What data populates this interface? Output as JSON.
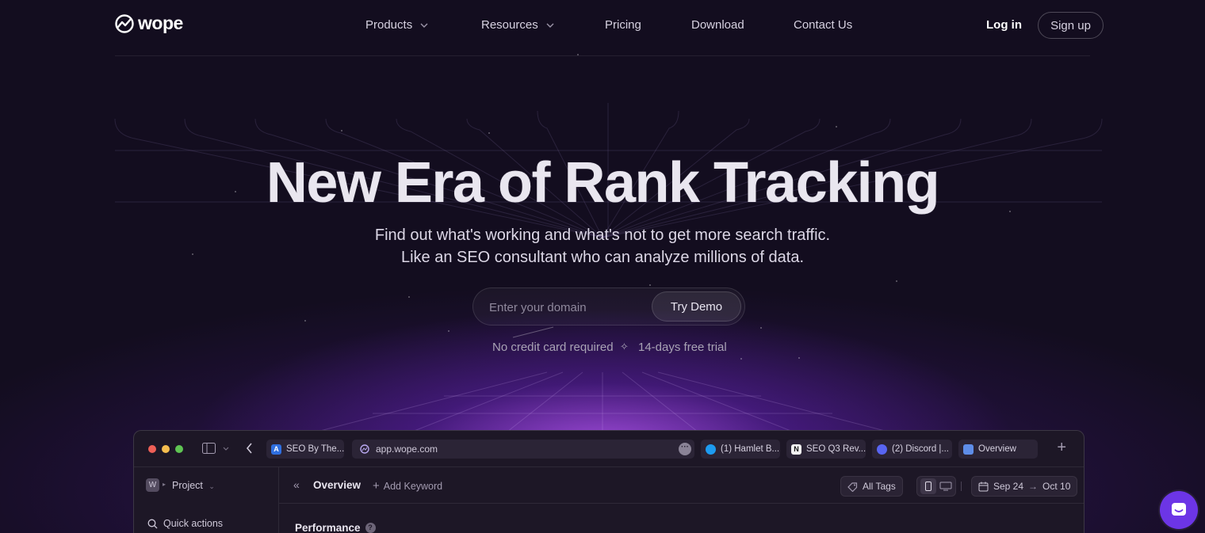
{
  "brand": {
    "name": "wope"
  },
  "nav": {
    "items": [
      {
        "label": "Products",
        "dropdown": true
      },
      {
        "label": "Resources",
        "dropdown": true
      },
      {
        "label": "Pricing",
        "dropdown": false
      },
      {
        "label": "Download",
        "dropdown": false
      },
      {
        "label": "Contact Us",
        "dropdown": false
      }
    ],
    "login": "Log in",
    "signup": "Sign up"
  },
  "hero": {
    "headline": "New Era of Rank Tracking",
    "subline1": "Find out what's working and what's not to get more search traffic.",
    "subline2": "Like an SEO consultant who can analyze millions of data.",
    "domain_placeholder": "Enter your domain",
    "cta": "Try Demo",
    "note_left": "No credit card required",
    "note_sep": "✧",
    "note_right": "14-days free trial"
  },
  "app_preview": {
    "url": "app.wope.com",
    "tabs": [
      {
        "label": "SEO By The...",
        "icon": "A"
      },
      {
        "label": "(1) Hamlet B...",
        "icon": "twitter-icon"
      },
      {
        "label": "SEO Q3 Rev...",
        "icon": "N"
      },
      {
        "label": "(2) Discord |...",
        "icon": "discord-icon"
      },
      {
        "label": "Overview",
        "icon": "shop-icon"
      }
    ],
    "sidebar": {
      "project_initial": "W",
      "project": "Project",
      "quick_actions": "Quick actions"
    },
    "toolbar": {
      "title": "Overview",
      "add_keyword": "Add Keyword",
      "tags": "All Tags",
      "date_from": "Sep 24",
      "date_to": "Oct 10"
    },
    "section": "Performance"
  },
  "colors": {
    "background": "#130d1f",
    "accent": "#6c35e6",
    "glow": "#be5aff"
  }
}
